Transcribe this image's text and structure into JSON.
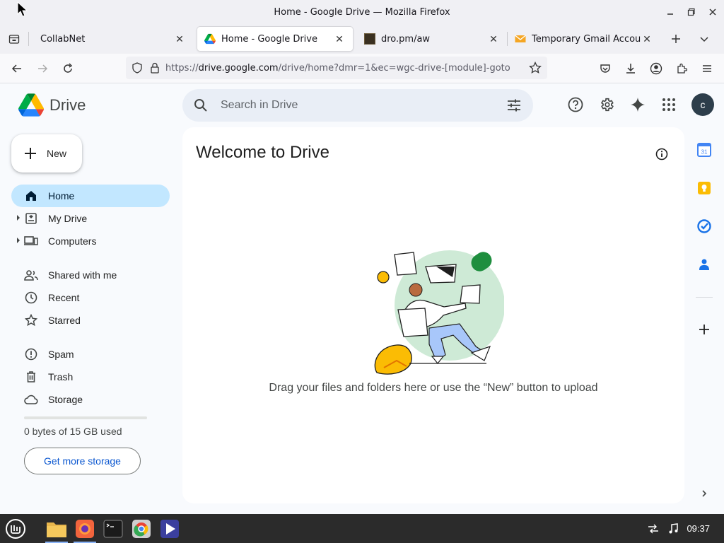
{
  "window": {
    "title": "Home - Google Drive — Mozilla Firefox"
  },
  "tabs": [
    {
      "title": "CollabNet",
      "active": false,
      "favicon": "none"
    },
    {
      "title": "Home - Google Drive",
      "active": true,
      "favicon": "google-drive-icon"
    },
    {
      "title": "dro.pm/aw",
      "active": false,
      "favicon": "dropm-icon"
    },
    {
      "title": "Temporary Gmail Account |",
      "active": false,
      "favicon": "mail-icon"
    }
  ],
  "urlbar": {
    "url_prefix": "https://",
    "url_host": "drive.google.com",
    "url_path": "/drive/home?dmr=1&ec=wgc-drive-[module]-goto"
  },
  "drive": {
    "app_name": "Drive",
    "search_placeholder": "Search in Drive",
    "avatar_letter": "c",
    "new_label": "New",
    "nav": {
      "home": "Home",
      "my_drive": "My Drive",
      "computers": "Computers",
      "shared": "Shared with me",
      "recent": "Recent",
      "starred": "Starred",
      "spam": "Spam",
      "trash": "Trash",
      "storage": "Storage"
    },
    "storage_used_fraction": 0,
    "storage_text": "0 bytes of 15 GB used",
    "get_more_storage": "Get more storage",
    "welcome_title": "Welcome to Drive",
    "drop_hint": "Drag your files and folders here or use the “New” button to upload",
    "calendar_day": "31"
  },
  "taskbar": {
    "clock": "09:37",
    "apps": [
      "menu-icon",
      "files-icon",
      "firefox-icon",
      "terminal-icon",
      "chrome-icon",
      "media-player-icon"
    ]
  },
  "colors": {
    "accent_blue": "#0b57d0",
    "active_nav": "#c2e7ff",
    "search_bg": "#e9eef6",
    "page_bg": "#f8fafd"
  }
}
